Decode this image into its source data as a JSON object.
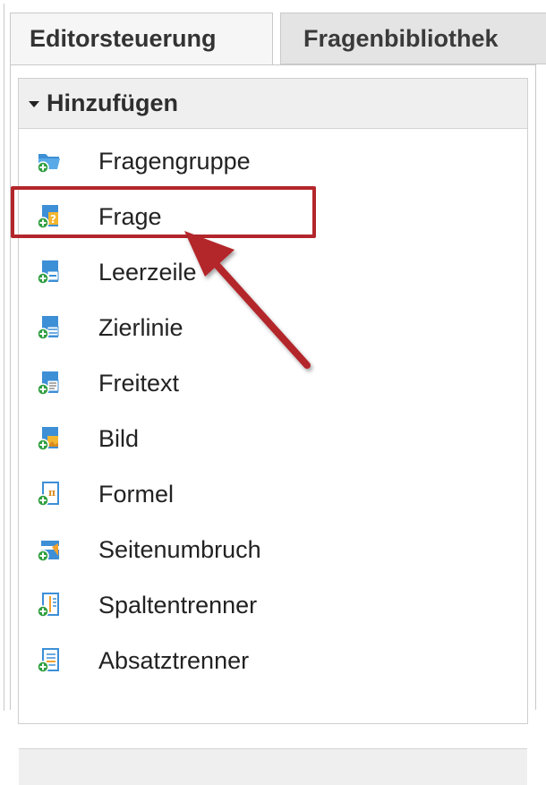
{
  "tabs": {
    "active": "Editorsteuerung",
    "inactive": "Fragenbibliothek"
  },
  "section": {
    "title": "Hinzufügen"
  },
  "items": [
    {
      "label": "Fragengruppe",
      "icon": "folder-add-icon"
    },
    {
      "label": "Frage",
      "icon": "question-add-icon"
    },
    {
      "label": "Leerzeile",
      "icon": "blank-line-add-icon"
    },
    {
      "label": "Zierlinie",
      "icon": "divider-line-add-icon"
    },
    {
      "label": "Freitext",
      "icon": "free-text-add-icon"
    },
    {
      "label": "Bild",
      "icon": "image-add-icon"
    },
    {
      "label": "Formel",
      "icon": "formula-add-icon"
    },
    {
      "label": "Seitenumbruch",
      "icon": "page-break-add-icon"
    },
    {
      "label": "Spaltentrenner",
      "icon": "column-separator-add-icon"
    },
    {
      "label": "Absatztrenner",
      "icon": "paragraph-separator-add-icon"
    }
  ],
  "annotation": {
    "highlight_color": "#b3262b",
    "highlighted_item": "Frage"
  }
}
